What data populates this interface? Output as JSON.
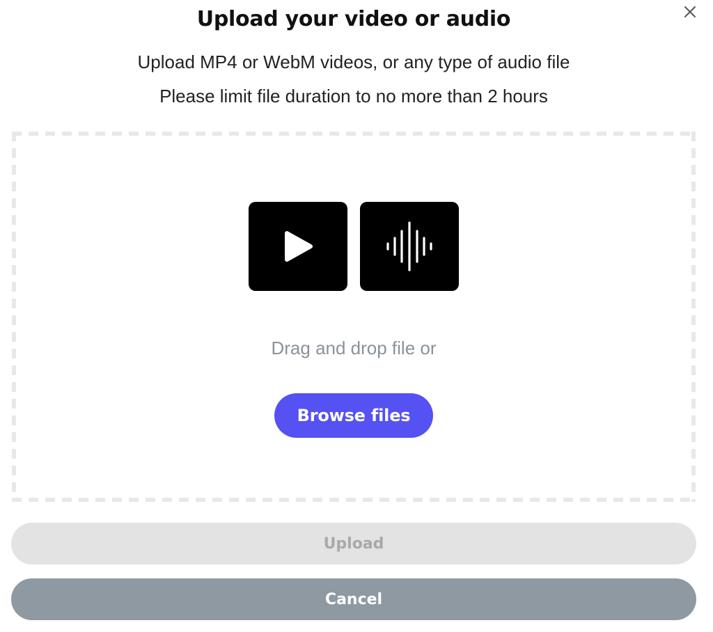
{
  "dialog": {
    "title": "Upload your video or audio",
    "subtitle_line1": "Upload MP4 or WebM videos, or any type of audio file",
    "subtitle_line2": "Please limit file duration to no more than 2 hours",
    "close_icon": "close-icon"
  },
  "dropzone": {
    "video_icon": "play-icon",
    "audio_icon": "audio-waveform-icon",
    "hint": "Drag and drop file or",
    "browse_label": "Browse files"
  },
  "actions": {
    "upload_label": "Upload",
    "upload_enabled": false,
    "cancel_label": "Cancel"
  },
  "colors": {
    "accent": "#5551f2",
    "disabled_bg": "#e3e3e3",
    "cancel_bg": "#8e99a2",
    "border_dash": "#e6e8eb"
  }
}
